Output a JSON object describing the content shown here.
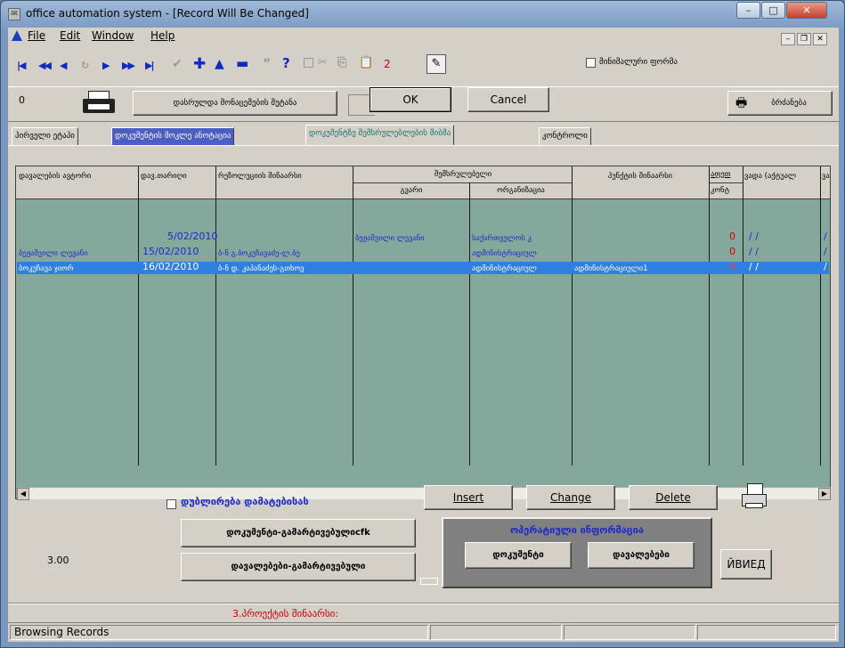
{
  "window": {
    "title": "office automation system - [Record Will Be Changed]",
    "controls": {
      "minimize": "–",
      "maximize": "□",
      "close": "✕"
    }
  },
  "menu": {
    "items": [
      "File",
      "Edit",
      "Window",
      "Help"
    ],
    "mdi": {
      "minimize": "–",
      "restore": "❐",
      "close": "✕"
    }
  },
  "toolbar": {
    "counter": "2",
    "minimal_form_label": "მინიმალური ფორმა"
  },
  "nav": {
    "record_count": "0",
    "finished_save_label": "დასრულდა მონაცემების შეტანა",
    "ok_label": "OK",
    "cancel_label": "Cancel",
    "print_label": "ბრძანება"
  },
  "tabs": [
    "პირველი ეტაპი",
    "დოკუმენტის მოკლე ანოტაცია",
    "დოკუმენტზე შემსრულებლების მიბმა",
    "კონტროლი"
  ],
  "grid": {
    "headers": {
      "c1": "დავალების ავტორი",
      "c2": "დავ.თარიღი",
      "c3": "რეზოლუციის შინაარსი",
      "group": "შემსრულებელი",
      "c4": "გვარი",
      "c5": "ორგანიზაცია",
      "c6": "პუნქტის შინაარსი",
      "c7a": "აფეთ",
      "c7b": "კონტ",
      "c8": "ვადა (აქტუალ",
      "c9": "ვად"
    },
    "rows": [
      {
        "author": "",
        "date": "5/02/2010",
        "resolution": "",
        "surname": "ბეჟაშვილი ლევანი",
        "org": "საქართველოს კ",
        "point": "",
        "flag": "0",
        "deadline": "/ /",
        "d2": "/"
      },
      {
        "author": "ბეჟაშვილი ლევანი",
        "date": "15/02/2010",
        "resolution": "ბ-ნ გ.ბოკუჩავაძე-ლ.ბე",
        "surname": "",
        "org": "ადმინისტრაციულ",
        "point": "",
        "flag": "0",
        "deadline": "/ /",
        "d2": "/"
      },
      {
        "author": "ბოკუჩავა ჯიორ",
        "date": "16/02/2010",
        "resolution": "ბ-ნ დ. კაპანაძეს-გთხოვ",
        "surname": "",
        "org": "ადმინისტრაციულ",
        "point": "ადმინისტრაციული1",
        "flag": "0",
        "deadline": "/ /",
        "d2": "/"
      }
    ],
    "selected_row": 2
  },
  "bottom": {
    "duplicate_label": "დუბლირება დამატებისას",
    "insert_label": "Insert",
    "change_label": "Change",
    "delete_label": "Delete",
    "version": "3.00",
    "doc_confirmed_label": "დოკუმენტი-გამარტივებულიcfk",
    "tasks_confirmed_label": "დავალებები-გამარტივებული",
    "ops_title": "ოპერატიული ინფორმაცია",
    "ops_doc_label": "დოკუმენტი",
    "ops_tasks_label": "დავალებები",
    "tydied_label": "ЙВИЕД",
    "project_content_label": "3.პროექტის შინაარსი:"
  },
  "status": {
    "text": "Browsing Records"
  },
  "colors": {
    "grid_bg": "#84a89c",
    "selection": "#2f7fe0",
    "blue_text": "#1a2ac8",
    "active_tab_text": "#17746a",
    "ops_panel": "#808080"
  }
}
